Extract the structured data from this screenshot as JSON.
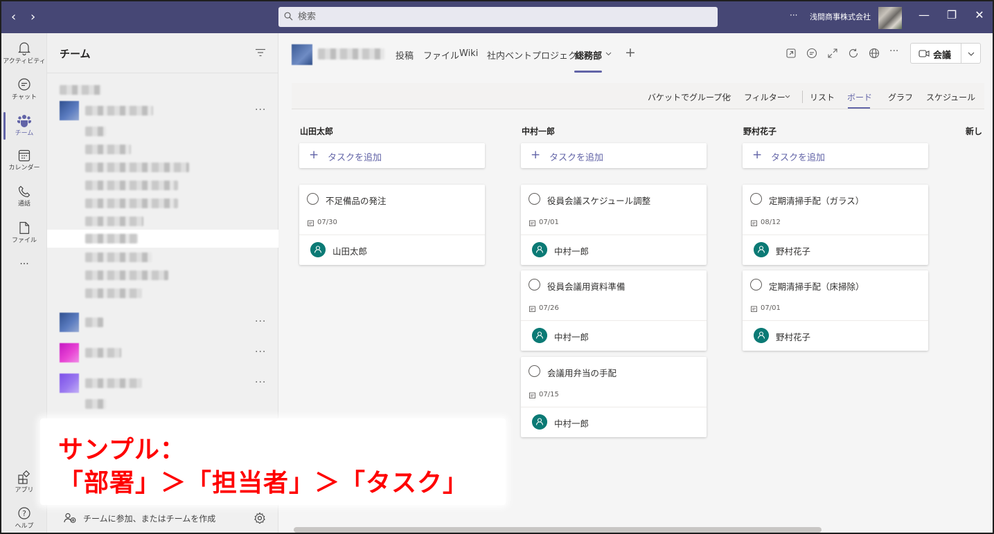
{
  "titlebar": {
    "back_icon": "chevron-left-icon",
    "forward_icon": "chevron-right-icon",
    "search_placeholder": "検索",
    "more": "···",
    "org_name": "浅間商事株式会社",
    "minimize": "—",
    "maximize": "❐",
    "close": "✕"
  },
  "rail": {
    "items": [
      {
        "label": "アクティビティ",
        "icon": "bell-icon"
      },
      {
        "label": "チャット",
        "icon": "chat-icon"
      },
      {
        "label": "チーム",
        "icon": "teams-icon"
      },
      {
        "label": "カレンダー",
        "icon": "calendar-icon"
      },
      {
        "label": "通話",
        "icon": "phone-icon"
      },
      {
        "label": "ファイル",
        "icon": "file-icon"
      }
    ],
    "more": "···",
    "apps_label": "アプリ",
    "help_label": "ヘルプ"
  },
  "teams_panel": {
    "title": "チーム",
    "more": "···",
    "footer_text": "チームに参加、またはチームを作成"
  },
  "channel": {
    "tabs": [
      "投稿",
      "ファイル",
      "Wiki",
      "社内ベントプロジェクト",
      "総務部"
    ],
    "active_tab": "総務部",
    "add_tab": "+",
    "more": "···",
    "meet_label": "会議"
  },
  "planner": {
    "toolbar": {
      "group_by": "バケットでグループ化",
      "filter": "フィルター",
      "list": "リスト",
      "board": "ボード",
      "chart": "グラフ",
      "schedule": "スケジュール"
    },
    "add_task_label": "タスクを追加",
    "buckets": [
      {
        "name": "山田太郎",
        "tasks": [
          {
            "title": "不足備品の発注",
            "due": "07/30",
            "assignee": "山田太郎"
          }
        ]
      },
      {
        "name": "中村一郎",
        "tasks": [
          {
            "title": "役員会議スケジュール調整",
            "due": "07/01",
            "assignee": "中村一郎"
          },
          {
            "title": "役員会議用資料準備",
            "due": "07/26",
            "assignee": "中村一郎"
          },
          {
            "title": "会議用弁当の手配",
            "due": "07/15",
            "assignee": "中村一郎"
          }
        ]
      },
      {
        "name": "野村花子",
        "tasks": [
          {
            "title": "定期清掃手配（ガラス）",
            "due": "08/12",
            "assignee": "野村花子"
          },
          {
            "title": "定期清掃手配（床掃除）",
            "due": "07/01",
            "assignee": "野村花子"
          }
        ]
      }
    ],
    "next_bucket_partial": "新し"
  },
  "caption": {
    "line1": "サンプル：",
    "line2": "「部署」＞「担当者」＞「タスク」"
  },
  "colors": {
    "titlebar": "#464775",
    "accent": "#6264a7",
    "avatar": "#0b7a75",
    "caption": "#ff0000"
  }
}
